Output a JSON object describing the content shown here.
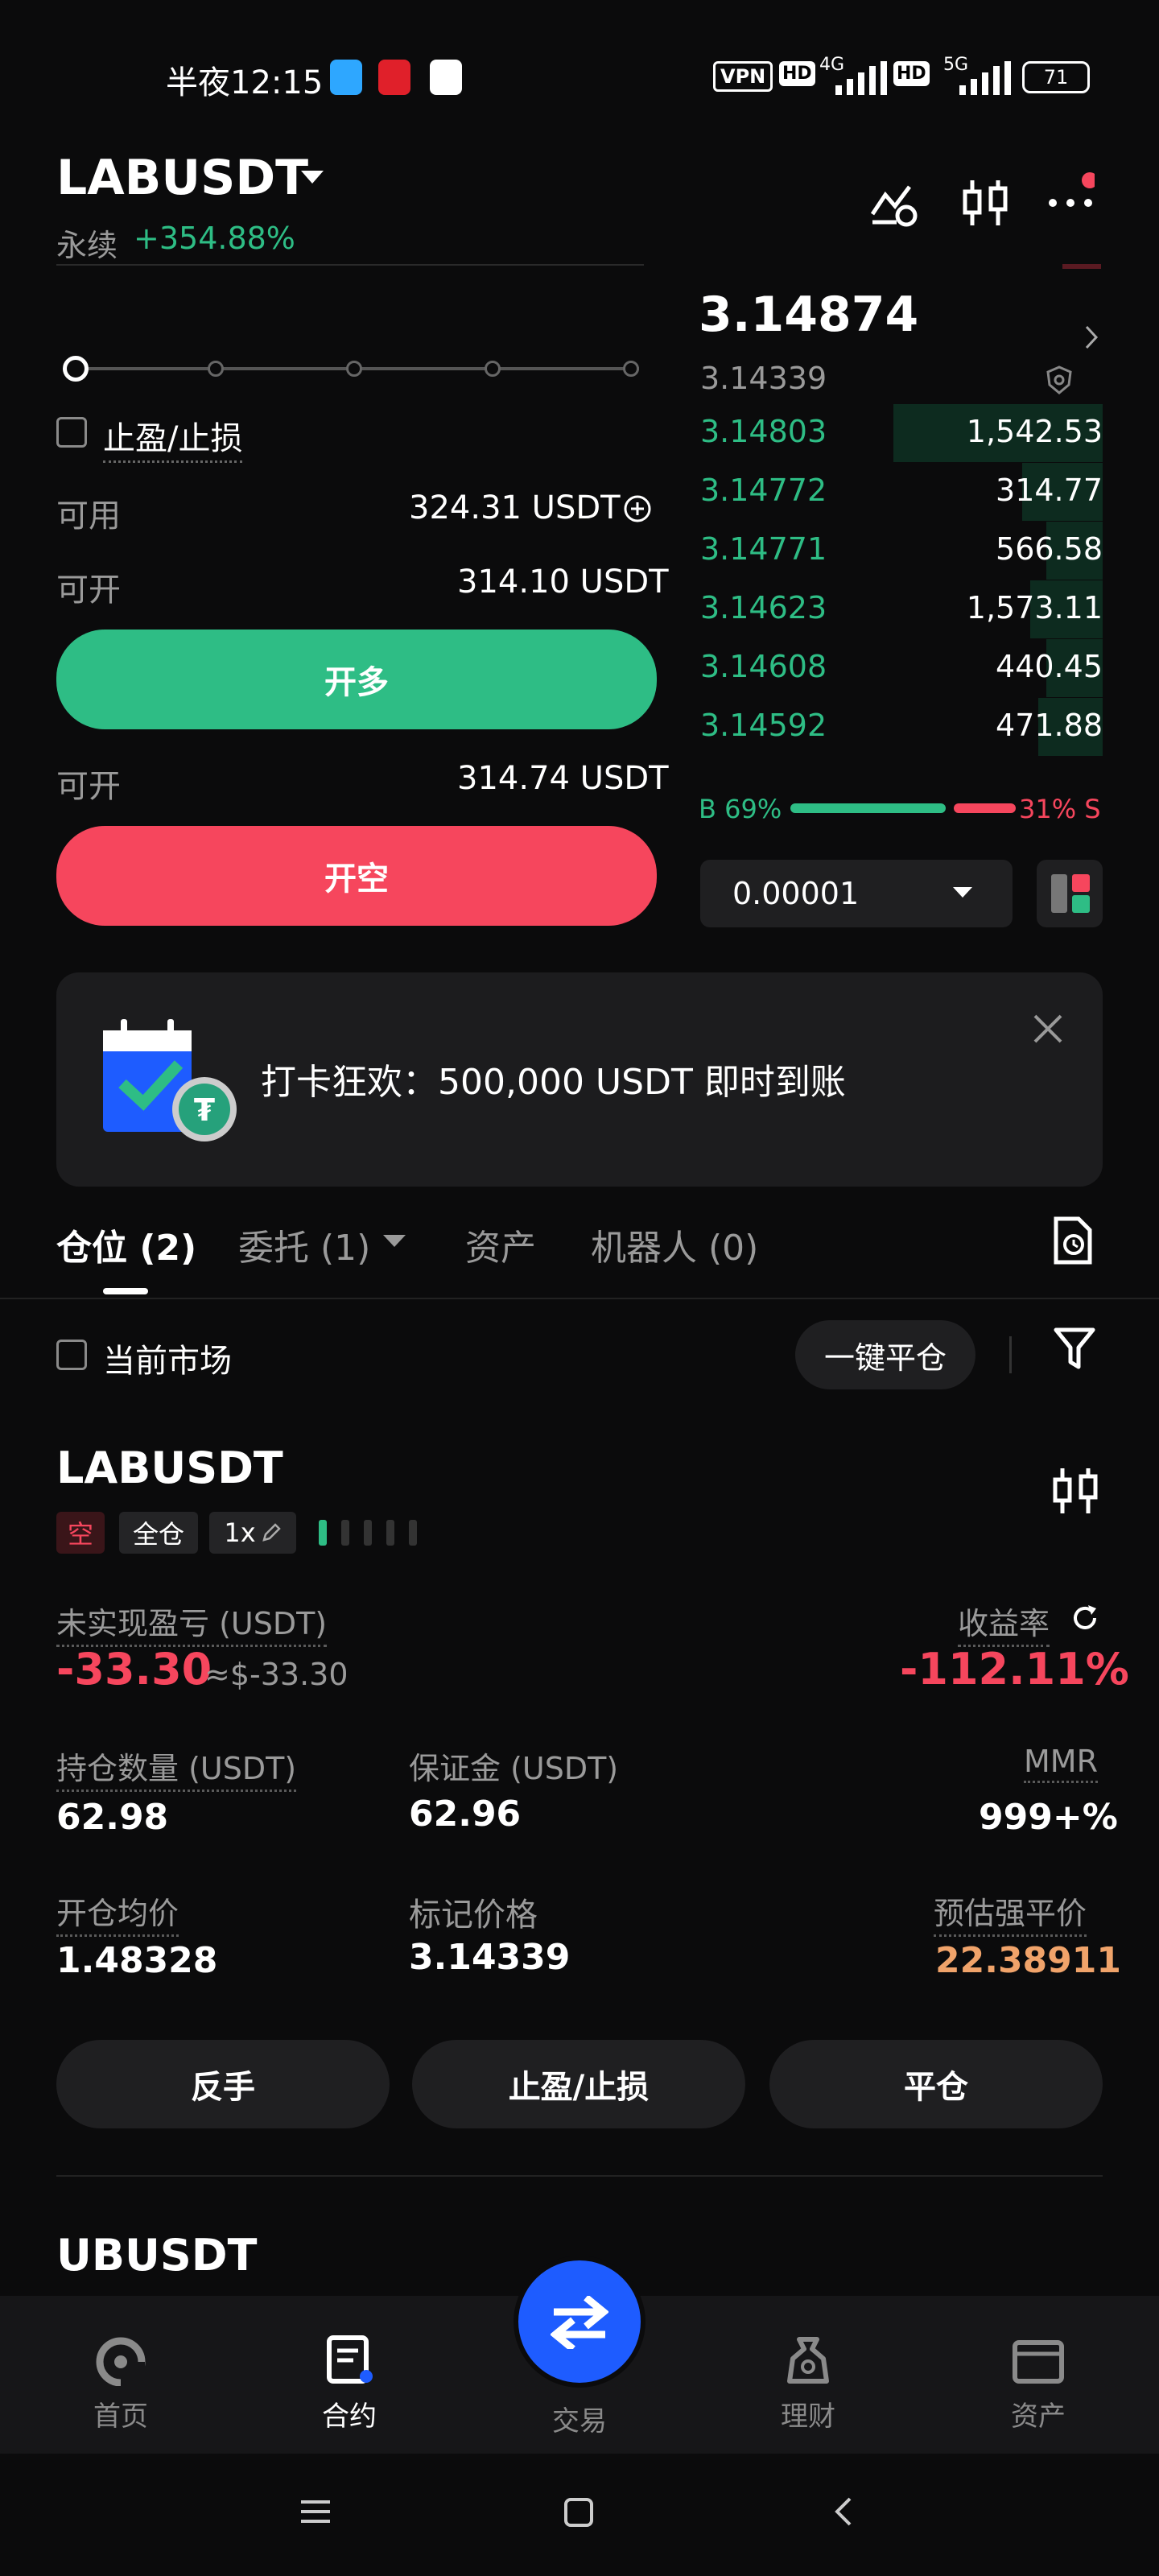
{
  "status_bar": {
    "time": "半夜12:15",
    "vpn": "VPN",
    "hd1": "HD",
    "net1": "4G",
    "hd2": "HD",
    "net2": "5G",
    "battery": "71"
  },
  "header": {
    "symbol": "LABUSDT",
    "subtitle": "永续",
    "change": "+354.88%"
  },
  "order_form": {
    "tp_sl_label": "止盈/止损",
    "available_label": "可用",
    "available_value": "324.31 USDT",
    "open_long_label": "可开",
    "open_long_value": "314.10 USDT",
    "long_button": "开多",
    "open_short_label": "可开",
    "open_short_value": "314.74 USDT",
    "short_button": "开空"
  },
  "orderbook": {
    "last_price": "3.14874",
    "mark_price": "3.14339",
    "bids": [
      {
        "price": "3.14803",
        "size": "1,542.53",
        "depth": 0.52
      },
      {
        "price": "3.14772",
        "size": "314.77",
        "depth": 0.2
      },
      {
        "price": "3.14771",
        "size": "566.58",
        "depth": 0.14
      },
      {
        "price": "3.14623",
        "size": "1,573.11",
        "depth": 0.18
      },
      {
        "price": "3.14608",
        "size": "440.45",
        "depth": 0.14
      },
      {
        "price": "3.14592",
        "size": "471.88",
        "depth": 0.16
      }
    ],
    "buy_ratio": "B 69%",
    "sell_ratio": "31% S",
    "buy_fraction": 0.69,
    "precision": "0.00001"
  },
  "banner": {
    "text": "打卡狂欢：500,000 USDT 即时到账"
  },
  "tabs": {
    "positions": "仓位 (2)",
    "orders": "委托 (1)",
    "assets": "资产",
    "bots": "机器人 (0)"
  },
  "filter": {
    "current_market": "当前市场",
    "close_all": "一键平仓"
  },
  "position": {
    "symbol": "LABUSDT",
    "side": "空",
    "margin_mode": "全仓",
    "leverage": "1x",
    "upnl_label": "未实现盈亏 (USDT)",
    "upnl_value": "-33.30",
    "upnl_usd": "≈$-33.30",
    "roe_label": "收益率",
    "roe_value": "-112.11%",
    "size_label": "持仓数量 (USDT)",
    "size_value": "62.98",
    "margin_label": "保证金 (USDT)",
    "margin_value": "62.96",
    "mmr_label": "MMR",
    "mmr_value": "999+%",
    "entry_label": "开仓均价",
    "entry_value": "1.48328",
    "mark_label": "标记价格",
    "mark_value": "3.14339",
    "liq_label": "预估强平价",
    "liq_value": "22.38911",
    "reverse_button": "反手",
    "tpsl_button": "止盈/止损",
    "close_button": "平仓"
  },
  "next_position": {
    "symbol": "UBUSDT"
  },
  "bottom_nav": {
    "home": "首页",
    "futures": "合约",
    "trade": "交易",
    "earn": "理财",
    "assets": "资产"
  },
  "colors": {
    "green": "#2ebd85",
    "red": "#f6465d",
    "orange": "#f0a36a",
    "blue": "#1e5cff"
  }
}
